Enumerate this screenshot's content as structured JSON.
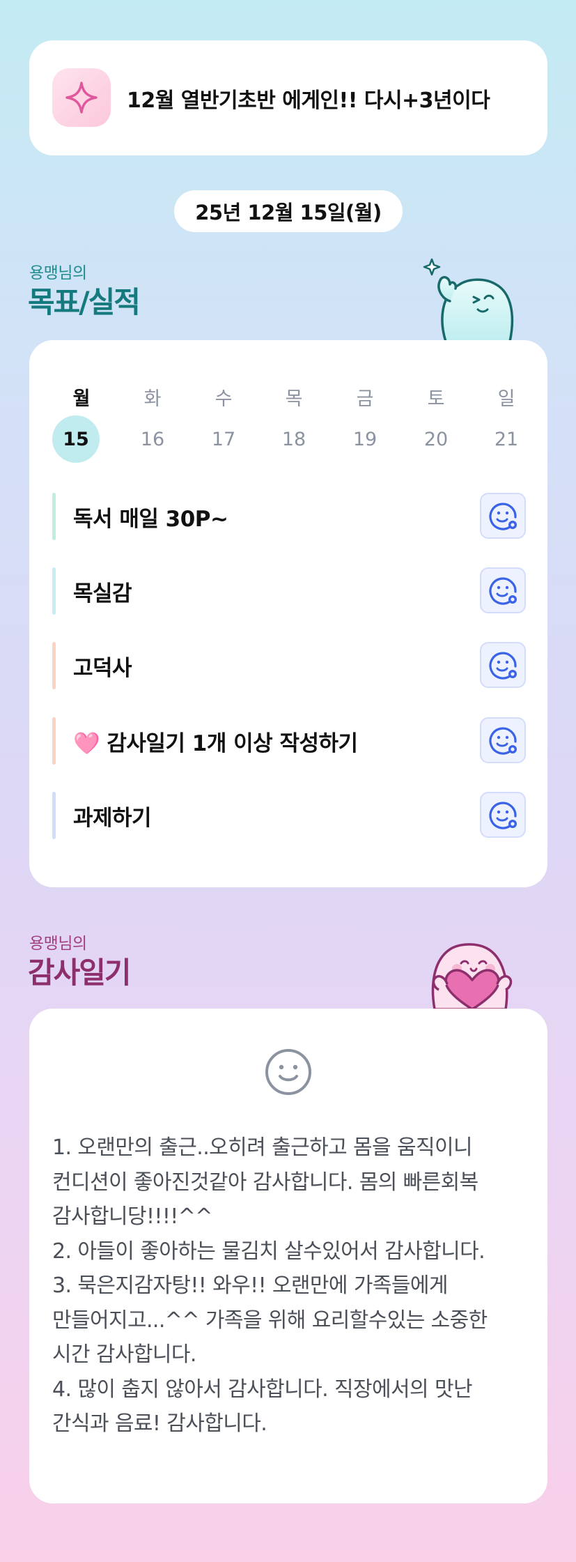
{
  "banner": {
    "icon": "sparkle-icon",
    "text": "12월 열반기초반 에게인!! 다시+3년이다"
  },
  "date_label": "25년 12월 15일(월)",
  "goals_section": {
    "subtitle": "용맹님의",
    "title": "목표/실적"
  },
  "week": {
    "days": [
      {
        "name": "월",
        "num": "15",
        "active": true
      },
      {
        "name": "화",
        "num": "16",
        "active": false
      },
      {
        "name": "수",
        "num": "17",
        "active": false
      },
      {
        "name": "목",
        "num": "18",
        "active": false
      },
      {
        "name": "금",
        "num": "19",
        "active": false
      },
      {
        "name": "토",
        "num": "20",
        "active": false
      },
      {
        "name": "일",
        "num": "21",
        "active": false
      }
    ]
  },
  "goals": [
    {
      "label": "독서 매일 30P~",
      "accent": "#bfeedd"
    },
    {
      "label": "목실감",
      "accent": "#c5edf2"
    },
    {
      "label": "고덕사",
      "accent": "#fbd3c3"
    },
    {
      "label": "🩷 감사일기 1개 이상 작성하기",
      "accent": "#fbd3c3"
    },
    {
      "label": "과제하기",
      "accent": "#d2def8"
    }
  ],
  "goal_button_icon": "smile-add-icon",
  "diary_section": {
    "subtitle": "용맹님의",
    "title": "감사일기",
    "icon": "smile-face-icon",
    "text": "1. 오랜만의 출근..오히려 출근하고 몸을 움직이니 컨디션이 좋아진것같아 감사합니다. 몸의 빠른회복 감사합니당!!!!^^\n2. 아들이 좋아하는 물김치 살수있어서 감사합니다.\n3. 묵은지감자탕!! 와우!! 오랜만에 가족들에게 만들어지고...^^ 가족을 위해 요리할수있는 소중한 시간 감사합니다.\n4. 많이 춥지 않아서 감사합니다. 직장에서의 맛난 간식과 음료! 감사합니다."
  },
  "colors": {
    "teal": "#1f8c8e",
    "plum": "#a23f7f",
    "accent_blue": "#3a63e6",
    "active_day": "#c1ecef"
  }
}
